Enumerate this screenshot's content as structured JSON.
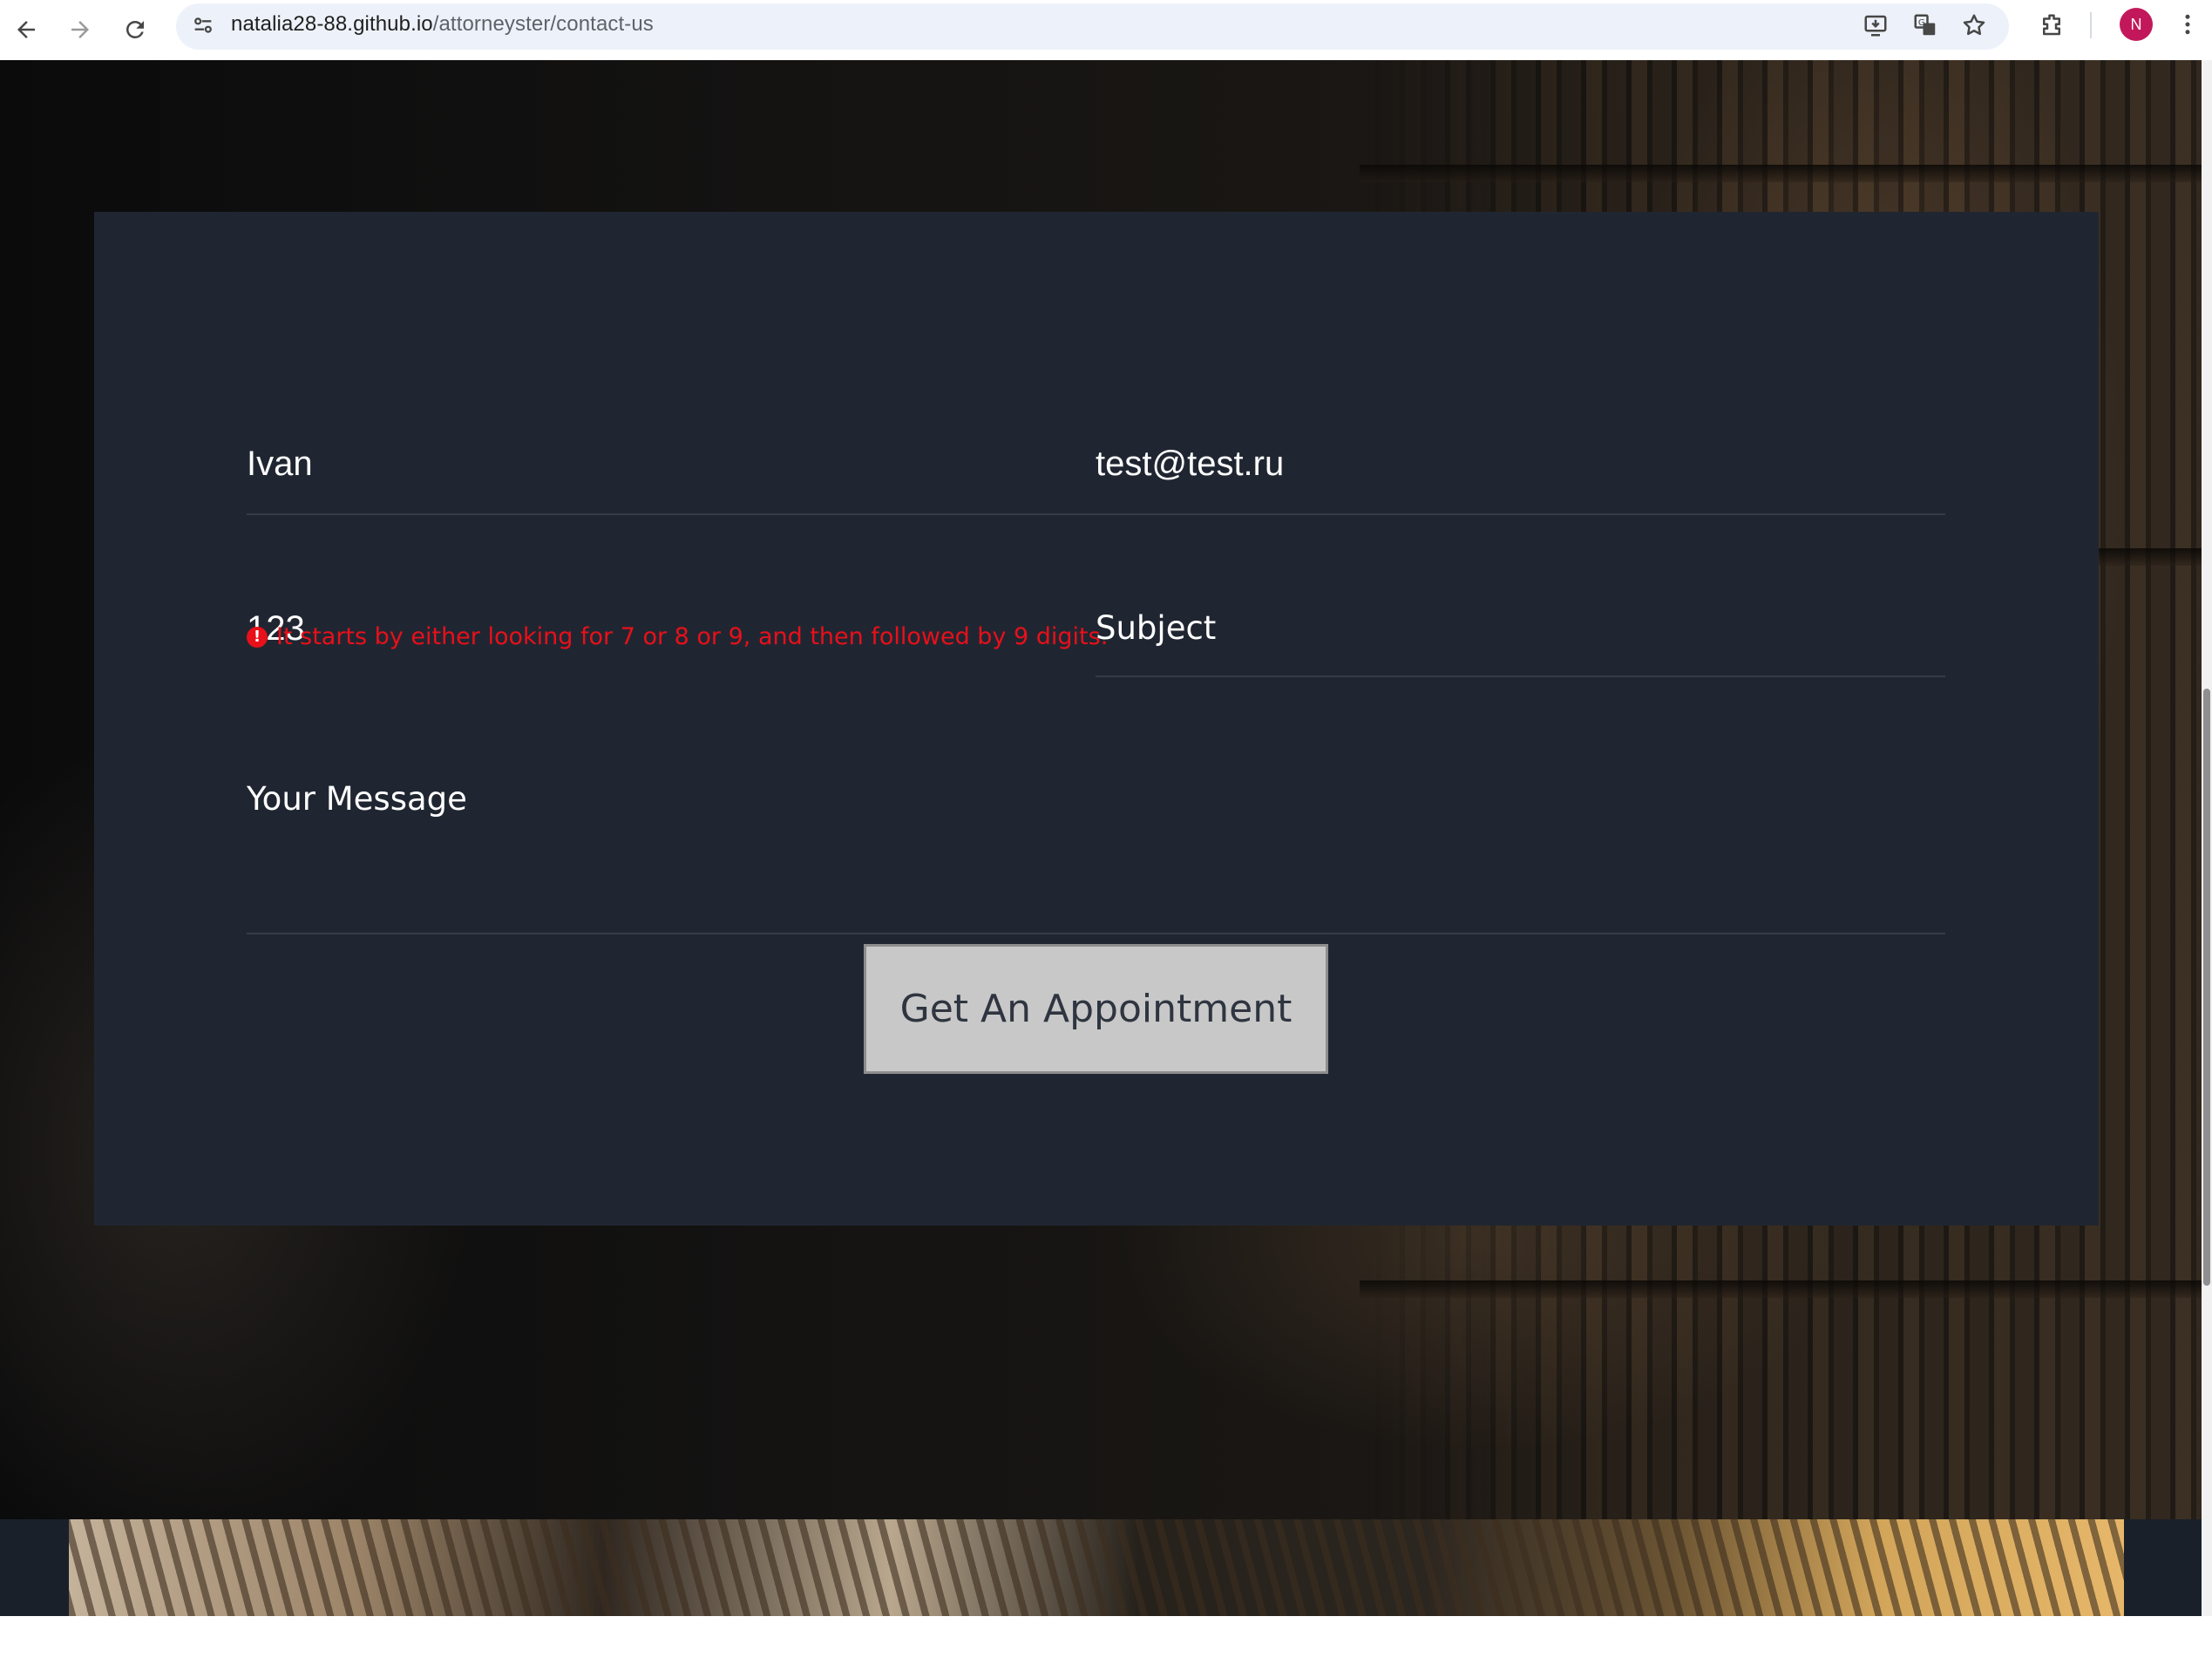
{
  "browser": {
    "url_domain": "natalia28-88.github.io",
    "url_path": "/attorneyster/contact-us",
    "profile_initial": "N"
  },
  "form": {
    "name_value": "Ivan",
    "email_value": "test@test.ru",
    "phone_value": "123",
    "subject_placeholder": "Subject",
    "message_placeholder": "Your Message",
    "phone_error": "It starts by either looking for 7 or 8 or 9, and then followed by 9 digits.",
    "submit_label": "Get An Appointment"
  },
  "colors": {
    "card_bg": "#202631",
    "error": "#e8101a",
    "button_bg": "#c8c8c8",
    "button_text": "#2f3540"
  }
}
